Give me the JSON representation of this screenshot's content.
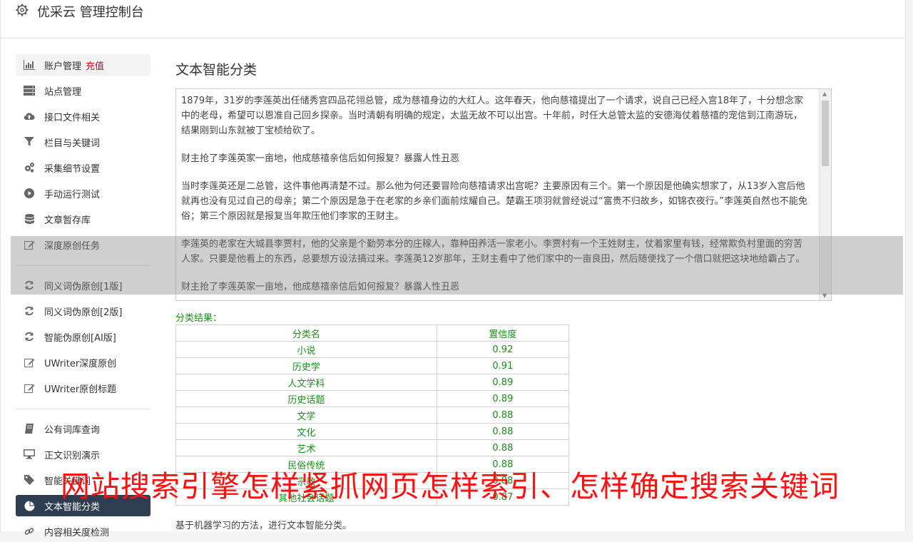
{
  "header": {
    "title": "优采云 管理控制台",
    "icon": "gear-icon"
  },
  "sidebar": {
    "items": [
      {
        "label": "账户管理",
        "badge": "充值",
        "icon": "bar-chart-icon"
      },
      {
        "label": "站点管理",
        "icon": "server-icon"
      },
      {
        "label": "接口文件相关",
        "icon": "cloud-upload-icon"
      },
      {
        "label": "栏目与关键词",
        "icon": "filter-icon"
      },
      {
        "label": "采集细节设置",
        "icon": "gears-icon"
      },
      {
        "label": "手动运行测试",
        "icon": "play-circle-icon"
      },
      {
        "label": "文章暂存库",
        "icon": "database-icon"
      },
      {
        "label": "深度原创任务",
        "icon": "edit-icon"
      },
      {
        "label": "同义词伪原创[1版]",
        "icon": "refresh-icon"
      },
      {
        "label": "同义词伪原创[2版]",
        "icon": "refresh-icon"
      },
      {
        "label": "智能伪原创[AI版]",
        "icon": "refresh-icon"
      },
      {
        "label": "UWriter深度原创",
        "icon": "edit-icon"
      },
      {
        "label": "UWriter原创标题",
        "icon": "edit-icon"
      },
      {
        "label": "公有词库查询",
        "icon": "book-icon"
      },
      {
        "label": "正文识别演示",
        "icon": "monitor-icon"
      },
      {
        "label": "智能关键词",
        "icon": "tag-icon"
      },
      {
        "label": "文本智能分类",
        "icon": "pie-chart-icon"
      },
      {
        "label": "内容相关度检测",
        "icon": "link-icon"
      }
    ]
  },
  "main": {
    "title": "文本智能分类",
    "text_paragraphs": [
      "1879年，31岁的李莲英出任储秀宫四品花翎总管，成为慈禧身边的大红人。这年春天，他向慈禧提出了一个请求，说自己已经入宫18年了，十分想念家中的老母，希望可以恩准自己回乡探亲。当时清朝有明确的规定，太监无故不可以出宫。十年前，时任大总管太监的安德海仗着慈禧的宠信到江南游玩，结果刚到山东就被丁宝桢给砍了。",
      "财主抢了李莲英家一亩地，他成慈禧亲信后如何报复？暴露人性丑恶",
      "当时李莲英还是二总管，这件事他再清楚不过。那么他为何还要冒险向慈禧请求出宫呢？主要原因有三个。第一个原因是他确实想家了，从13岁入宫后他就再也没有见过自己的母亲；第二个原因是急于在老家的乡亲们面前炫耀自己。楚霸王项羽就曾经说过“富贵不归故乡，如锦衣夜行。”李莲英自然也不能免俗；第三个原因就是报复当年欺压他们李家的王财主。",
      "李莲英的老家在大城县李贾村，他的父亲是个勤劳本分的庄稼人，靠种田养活一家老小。李贾村有一个王姓财主，仗着家里有钱，经常欺负村里面的穷苦人家。只要是他看上的东西，总要想方设法搞过来。李莲英12岁那年，王财主看中了他们家中的一亩良田，然后随便找了一个借口就把这块地给霸占了。",
      "财主抢了李莲英家一亩地，他成慈禧亲信后如何报复？暴露人性丑恶"
    ],
    "result_label": "分类结果：",
    "table": {
      "headers": [
        "分类名",
        "置信度"
      ],
      "rows": [
        [
          "小说",
          "0.92"
        ],
        [
          "历史学",
          "0.91"
        ],
        [
          "人文学科",
          "0.89"
        ],
        [
          "历史话题",
          "0.89"
        ],
        [
          "文学",
          "0.88"
        ],
        [
          "文化",
          "0.88"
        ],
        [
          "艺术",
          "0.88"
        ],
        [
          "民俗传统",
          "0.88"
        ],
        [
          "宗教",
          "0.88"
        ],
        [
          "其他社会话题",
          "0.87"
        ]
      ]
    },
    "footer_note": "基于机器学习的方法，进行文本智能分类。"
  },
  "watermark": "网站搜索引擎怎样紧抓网页怎样索引、怎样确定搜索关键词",
  "colors": {
    "accent_green": "#1e8a1e",
    "active_nav": "#2f3d53",
    "recharge_red": "#d9001b",
    "watermark_red": "#ff1010"
  }
}
